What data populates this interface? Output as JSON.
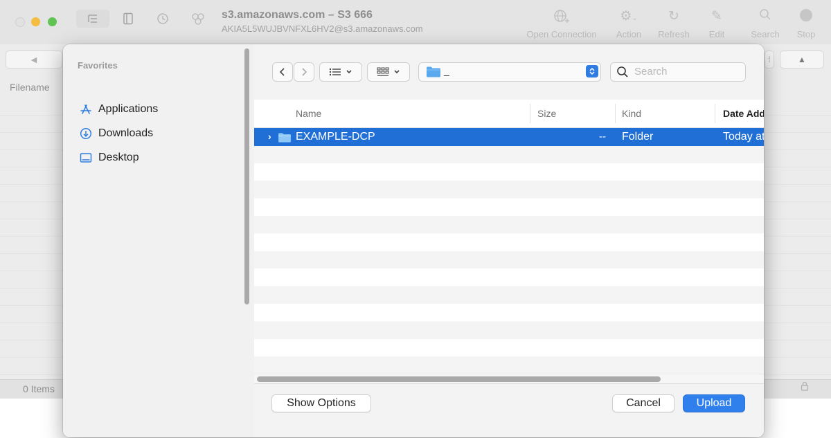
{
  "background_window": {
    "title": "s3.amazonaws.com – S3 666",
    "subtitle": "AKIA5L5WUJBVNFXL6HV2@s3.amazonaws.com",
    "toolbar": [
      {
        "label": "Open Connection",
        "icon": "globe-plus-icon"
      },
      {
        "label": "Action",
        "icon": "gear-icon"
      },
      {
        "label": "Refresh",
        "icon": "refresh-icon"
      },
      {
        "label": "Edit",
        "icon": "pencil-icon"
      },
      {
        "label": "Search",
        "icon": "search-icon"
      },
      {
        "label": "Stop",
        "icon": "stop-icon"
      }
    ],
    "column_header": "Filename",
    "status": "0 Items"
  },
  "panel": {
    "sidebar": {
      "section_title": "Favorites",
      "items": [
        {
          "label": "Applications",
          "icon": "applications-icon"
        },
        {
          "label": "Downloads",
          "icon": "downloads-icon"
        },
        {
          "label": "Desktop",
          "icon": "desktop-icon"
        }
      ]
    },
    "location": "_",
    "search_placeholder": "Search",
    "columns": {
      "name": "Name",
      "size": "Size",
      "kind": "Kind",
      "date": "Date Added"
    },
    "rows": [
      {
        "name": "EXAMPLE-DCP",
        "size": "--",
        "kind": "Folder",
        "date": "Today at",
        "selected": true
      }
    ],
    "buttons": {
      "show_options": "Show Options",
      "cancel": "Cancel",
      "upload": "Upload"
    }
  },
  "colors": {
    "accent": "#2f80ed",
    "selection": "#1f6fd6",
    "traffic_yellow": "#f5bd3f",
    "traffic_green": "#5fc453"
  }
}
